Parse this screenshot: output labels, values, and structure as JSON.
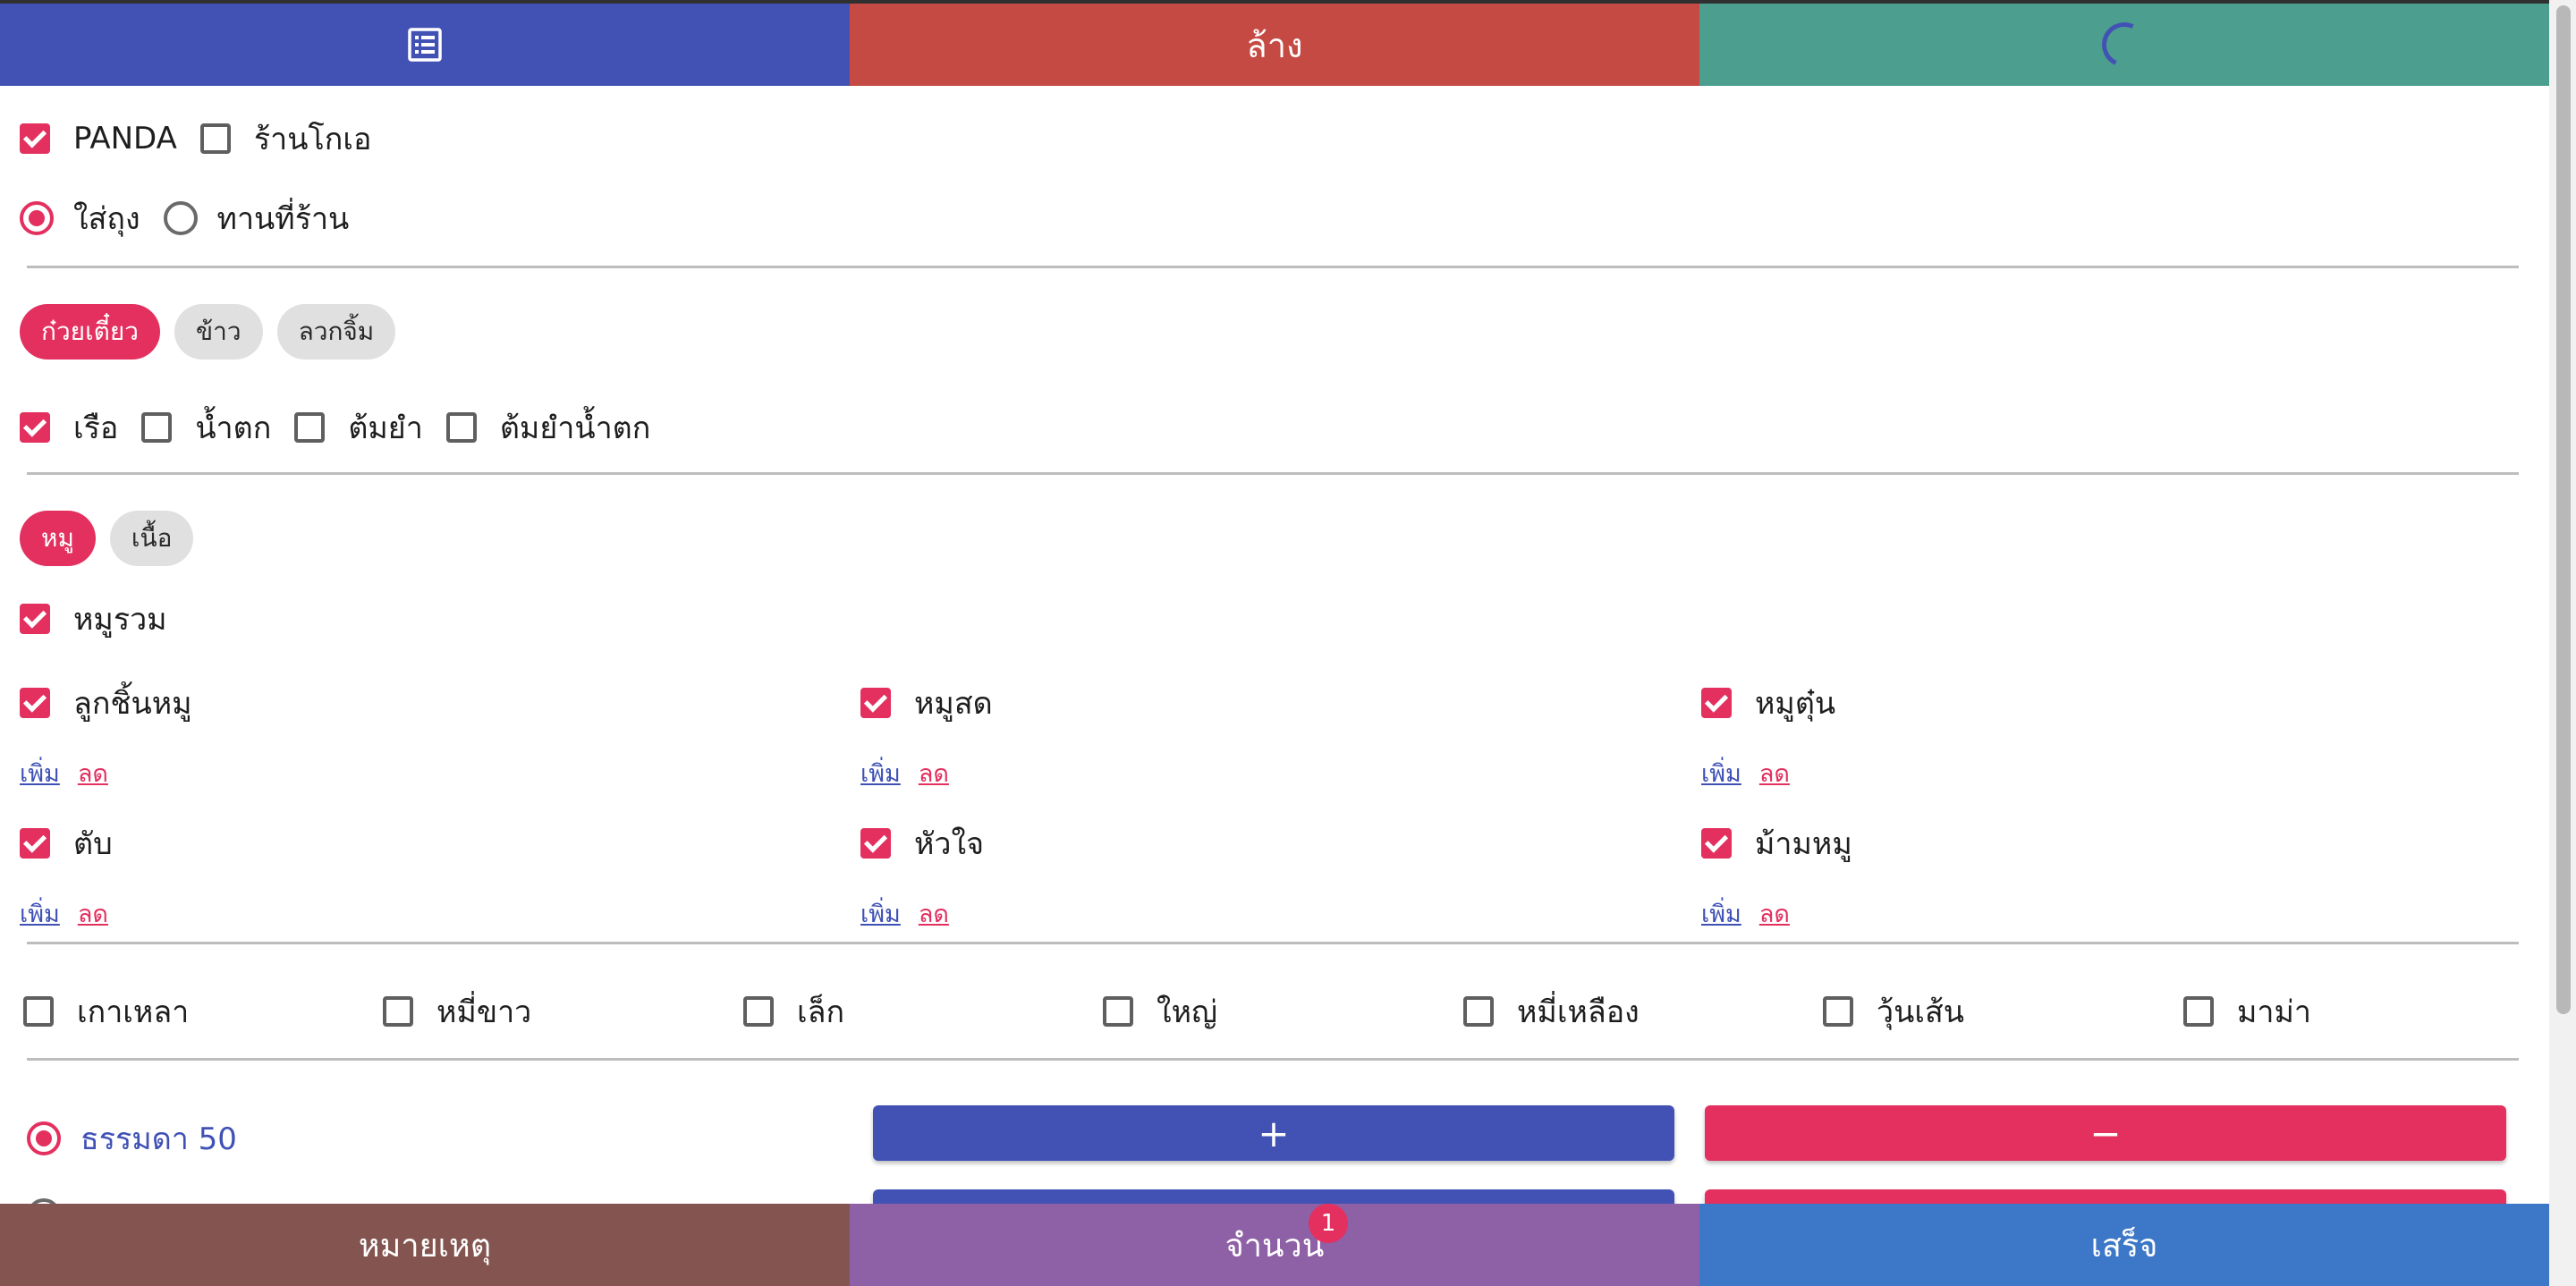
{
  "top_bar": {
    "list_icon": "list-icon",
    "clear_label": "ล้าง",
    "loading_icon": "spinner-icon"
  },
  "shops": [
    {
      "label": "PANDA",
      "checked": true
    },
    {
      "label": "ร้านโกเอ",
      "checked": false
    }
  ],
  "service": [
    {
      "label": "ใส่ถุง",
      "selected": true
    },
    {
      "label": "ทานที่ร้าน",
      "selected": false
    }
  ],
  "categories": [
    {
      "label": "ก๋วยเตี๋ยว",
      "active": true
    },
    {
      "label": "ข้าว",
      "active": false
    },
    {
      "label": "ลวกจิ้ม",
      "active": false
    }
  ],
  "soups": [
    {
      "label": "เรือ",
      "checked": true
    },
    {
      "label": "น้ำตก",
      "checked": false
    },
    {
      "label": "ต้มยำ",
      "checked": false
    },
    {
      "label": "ต้มยำน้ำตก",
      "checked": false
    }
  ],
  "meat_tabs": [
    {
      "label": "หมู",
      "active": true
    },
    {
      "label": "เนื้อ",
      "active": false
    }
  ],
  "meat_all": {
    "label": "หมูรวม",
    "checked": true
  },
  "meats": [
    {
      "label": "ลูกชิ้นหมู",
      "checked": true,
      "add": "เพิ่ม",
      "reduce": "ลด"
    },
    {
      "label": "หมูสด",
      "checked": true,
      "add": "เพิ่ม",
      "reduce": "ลด"
    },
    {
      "label": "หมูตุ๋น",
      "checked": true,
      "add": "เพิ่ม",
      "reduce": "ลด"
    },
    {
      "label": "ตับ",
      "checked": true,
      "add": "เพิ่ม",
      "reduce": "ลด"
    },
    {
      "label": "หัวใจ",
      "checked": true,
      "add": "เพิ่ม",
      "reduce": "ลด"
    },
    {
      "label": "ม้ามหมู",
      "checked": true,
      "add": "เพิ่ม",
      "reduce": "ลด"
    }
  ],
  "noodles": [
    {
      "label": "เกาเหลา",
      "checked": false
    },
    {
      "label": "หมี่ขาว",
      "checked": false
    },
    {
      "label": "เล็ก",
      "checked": false
    },
    {
      "label": "ใหญ่",
      "checked": false
    },
    {
      "label": "หมี่เหลือง",
      "checked": false
    },
    {
      "label": "วุ้นเส้น",
      "checked": false
    },
    {
      "label": "มาม่า",
      "checked": false
    }
  ],
  "sizes": [
    {
      "label": "ธรรมดา 50",
      "selected": true
    }
  ],
  "size_buttons": {
    "plus": "+",
    "minus": "−"
  },
  "bottom_bar": {
    "note_label": "หมายเหตุ",
    "qty_label": "จำนวน",
    "qty_badge": "1",
    "done_label": "เสร็จ"
  },
  "colors": {
    "primary": "#4252b4",
    "accent": "#e3305f",
    "clear": "#c54a43",
    "loading": "#4c9f8e",
    "note": "#845550",
    "qty": "#8e60a5",
    "done": "#3d78c8"
  }
}
